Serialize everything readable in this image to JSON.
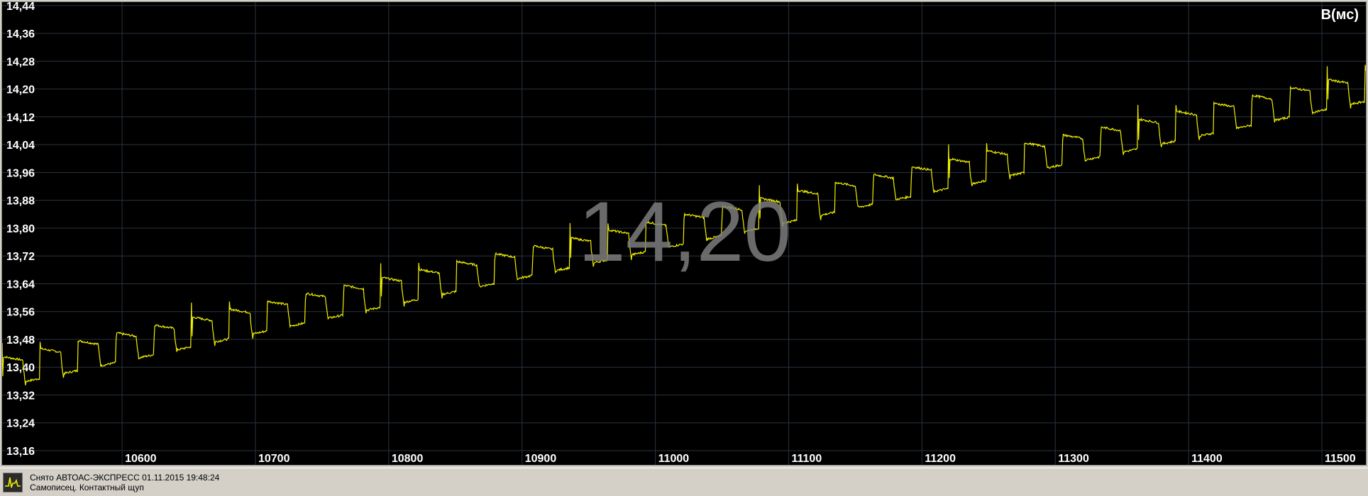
{
  "chart_data": {
    "type": "line",
    "unit_label": "В(мс)",
    "readout": "14,20",
    "colors": {
      "background": "#000000",
      "grid": "#2a3440",
      "line": "#f0f000",
      "readout": "#7d7d7d"
    },
    "grid": true,
    "xlim": [
      10510,
      11533
    ],
    "ylim": [
      13.16,
      14.45
    ],
    "y_ticks": [
      {
        "value": 13.16,
        "label": "13,16"
      },
      {
        "value": 13.24,
        "label": "13,24"
      },
      {
        "value": 13.32,
        "label": "13,32"
      },
      {
        "value": 13.4,
        "label": "13,40"
      },
      {
        "value": 13.48,
        "label": "13,48"
      },
      {
        "value": 13.56,
        "label": "13,56"
      },
      {
        "value": 13.64,
        "label": "13,64"
      },
      {
        "value": 13.72,
        "label": "13,72"
      },
      {
        "value": 13.8,
        "label": "13,80"
      },
      {
        "value": 13.88,
        "label": "13,88"
      },
      {
        "value": 13.96,
        "label": "13,96"
      },
      {
        "value": 14.04,
        "label": "14,04"
      },
      {
        "value": 14.12,
        "label": "14,12"
      },
      {
        "value": 14.2,
        "label": "14,20"
      },
      {
        "value": 14.28,
        "label": "14,28"
      },
      {
        "value": 14.36,
        "label": "14,36"
      },
      {
        "value": 14.44,
        "label": "14,44"
      }
    ],
    "x_ticks": [
      {
        "value": 10600,
        "label": "10600"
      },
      {
        "value": 10700,
        "label": "10700"
      },
      {
        "value": 10800,
        "label": "10800"
      },
      {
        "value": 10900,
        "label": "10900"
      },
      {
        "value": 11000,
        "label": "11000"
      },
      {
        "value": 11100,
        "label": "11100"
      },
      {
        "value": 11200,
        "label": "11200"
      },
      {
        "value": 11300,
        "label": "11300"
      },
      {
        "value": 11400,
        "label": "11400"
      },
      {
        "value": 11500,
        "label": "11500"
      }
    ],
    "series": [
      {
        "pulse_period_ms": 28.4,
        "x_start": 10510,
        "x_end": 11533,
        "baseline": [
          {
            "x": 10510,
            "y": 13.36
          },
          {
            "x": 11533,
            "y": 14.18
          }
        ],
        "pulse_step_up": 0.07,
        "spike_height": 0.11
      }
    ]
  },
  "status": {
    "line1": "Снято АВТОАС-ЭКСПРЕСС 01.11.2015 19:48:24",
    "line2": "Самописец. Контактный щуп"
  }
}
